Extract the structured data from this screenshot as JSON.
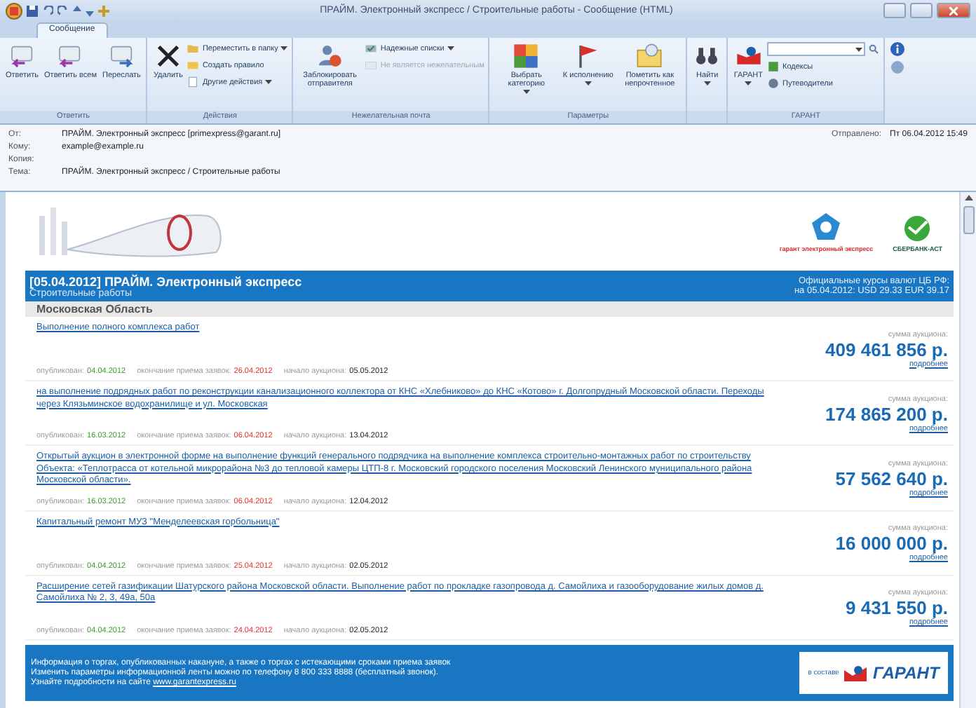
{
  "window": {
    "title": "ПРАЙМ. Электронный экспресс / Строительные работы - Сообщение (HTML)"
  },
  "ribbon": {
    "tabs": [
      {
        "label": "Сообщение",
        "selected": true
      }
    ],
    "groups": [
      {
        "label": "Ответить",
        "buttons": [
          {
            "kind": "large",
            "label": "Ответить",
            "dropdown": false,
            "disabled": false
          },
          {
            "kind": "large",
            "label": "Ответить всем",
            "dropdown": false,
            "disabled": false
          },
          {
            "kind": "large",
            "label": "Переслать",
            "dropdown": false,
            "disabled": false
          }
        ]
      },
      {
        "label": "Действия",
        "buttons": [
          {
            "kind": "large",
            "label": "Удалить",
            "dropdown": false,
            "disabled": false
          },
          {
            "kind": "small",
            "label": "Переместить в папку",
            "dropdown": true,
            "disabled": false
          },
          {
            "kind": "small",
            "label": "Создать правило",
            "dropdown": false,
            "disabled": false
          },
          {
            "kind": "small",
            "label": "Другие действия",
            "dropdown": true,
            "disabled": false
          }
        ]
      },
      {
        "label": "Нежелательная почта",
        "buttons": [
          {
            "kind": "large",
            "label": "Заблокировать отправителя",
            "dropdown": false,
            "disabled": false
          },
          {
            "kind": "small",
            "label": "Надежные списки",
            "dropdown": true,
            "disabled": false
          },
          {
            "kind": "small",
            "label": "Не является нежелательным",
            "dropdown": false,
            "disabled": true
          }
        ]
      },
      {
        "label": "Параметры",
        "buttons": [
          {
            "kind": "large",
            "label": "Выбрать категорию",
            "dropdown": true,
            "disabled": false
          },
          {
            "kind": "large",
            "label": "К исполнению",
            "dropdown": true,
            "disabled": false
          },
          {
            "kind": "large",
            "label": "Пометить как непрочтенное",
            "dropdown": false,
            "disabled": false
          }
        ]
      },
      {
        "buttons": [
          {
            "kind": "large",
            "label": "Найти",
            "dropdown": true,
            "disabled": false
          }
        ]
      },
      {
        "label": "ГАРАНТ",
        "buttons": [
          {
            "kind": "large",
            "label": "ГАРАНТ",
            "dropdown": true,
            "disabled": false
          },
          {
            "kind": "search"
          },
          {
            "kind": "small",
            "label": "Кодексы",
            "dropdown": false,
            "disabled": false
          },
          {
            "kind": "small",
            "label": "Путеводители",
            "dropdown": false,
            "disabled": false
          }
        ]
      }
    ]
  },
  "header": {
    "fields": [
      {
        "label": "От:",
        "value": "ПРАЙМ. Электронный экспресс [primexpress@garant.ru]"
      },
      {
        "label": "Кому:",
        "value": "example@example.ru"
      },
      {
        "label": "Копия:"
      },
      {
        "label": "Тема:",
        "value": "ПРАЙМ. Электронный экспресс / Строительные работы"
      }
    ],
    "sent": {
      "label": "Отправлено:",
      "value": "Пт 06.04.2012 15:49"
    }
  },
  "email": {
    "logos": {
      "left_caption": "гарант электронный экспресс",
      "right_caption": "СБЕРБАНК-АСТ"
    },
    "title": "[05.04.2012] ПРАЙМ. Электронный экспресс",
    "subtitle": "Строительные работы",
    "rates": [
      "Официальные курсы валют ЦБ РФ:",
      "на 05.04.2012: USD 29.33 EUR 39.17"
    ],
    "region": "Московская Область",
    "tenders": [
      {
        "title": "Выполнение полного комплекса работ",
        "published_label": "опубликован:",
        "published": "04.04.2012",
        "deadline_label": "окончание приема заявок:",
        "deadline": "26.04.2012",
        "start_label": "начало аукциона:",
        "start": "05.05.2012",
        "amount_label": "сумма аукциона:",
        "amount": "409 461 856 р.",
        "more": "подробнее"
      },
      {
        "title": "на выполнение подрядных работ по реконструкции канализационного коллектора от КНС «Хлебниково» до КНС «Котово» г. Долгопрудный Московской области. Переходы через Клязьминское водохранилище и ул. Московская",
        "published_label": "опубликован:",
        "published": "16.03.2012",
        "deadline_label": "окончание приема заявок:",
        "deadline": "06.04.2012",
        "start_label": "начало аукциона:",
        "start": "13.04.2012",
        "amount_label": "сумма аукциона:",
        "amount": "174 865 200 р.",
        "more": "подробнее"
      },
      {
        "title": "Открытый аукцион в электронной форме на выполнение функций генерального подрядчика на выполнение комплекса строительно-монтажных работ по строительству Объекта: «Теплотрасса от котельной микрорайона №3 до тепловой камеры ЦТП-8 г. Московский городского поселения Московский Ленинского муниципального района Московской области».",
        "published_label": "опубликован:",
        "published": "16.03.2012",
        "deadline_label": "окончание приема заявок:",
        "deadline": "06.04.2012",
        "start_label": "начало аукциона:",
        "start": "12.04.2012",
        "amount_label": "сумма аукциона:",
        "amount": "57 562 640 р.",
        "more": "подробнее"
      },
      {
        "title": "Капитальный ремонт МУЗ \"Менделеевская горбольница\"",
        "published_label": "опубликован:",
        "published": "04.04.2012",
        "deadline_label": "окончание приема заявок:",
        "deadline": "25.04.2012",
        "start_label": "начало аукциона:",
        "start": "02.05.2012",
        "amount_label": "сумма аукциона:",
        "amount": "16 000 000 р.",
        "more": "подробнее"
      },
      {
        "title": "Расширение сетей газификации Шатурского района Московской области. Выполнение работ по прокладке газопровода д. Самойлиха и газооборудование жилых домов д. Самойлиха № 2, 3, 49а, 50а",
        "published_label": "опубликован:",
        "published": "04.04.2012",
        "deadline_label": "окончание приема заявок:",
        "deadline": "24.04.2012",
        "start_label": "начало аукциона:",
        "start": "02.05.2012",
        "amount_label": "сумма аукциона:",
        "amount": "9 431 550 р.",
        "more": "подробнее"
      }
    ],
    "footer": {
      "lines": [
        "Информация о торгах, опубликованных накануне, а также о торгах с истекающими сроками приема заявок",
        "Изменить параметры информационной ленты можно по телефону 8 800 333 8888 (бесплатный звонок)."
      ],
      "link_prefix": "Узнайте подробности на сайте",
      "link": "www.garantexpress.ru",
      "logo_prefix": "в составе",
      "logo": "ГАРАНТ"
    }
  }
}
